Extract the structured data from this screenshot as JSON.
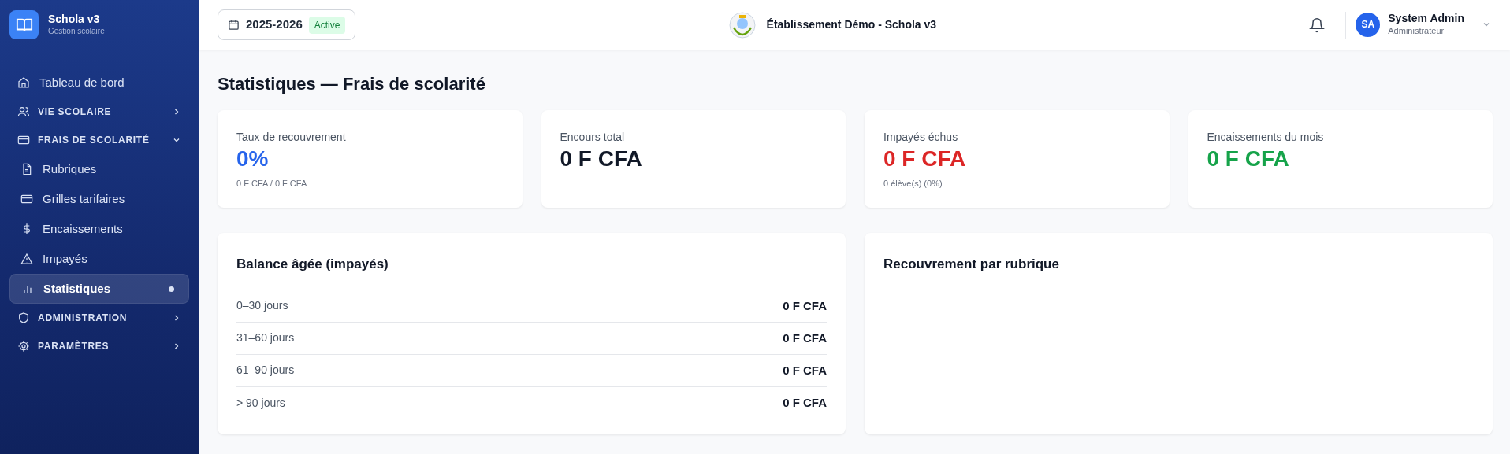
{
  "brand": {
    "name": "Schola v3",
    "subtitle": "Gestion scolaire"
  },
  "sidebar": {
    "items": [
      {
        "kind": "link",
        "label": "Tableau de bord",
        "selected": false
      },
      {
        "kind": "section",
        "label": "VIE SCOLAIRE",
        "expanded": false
      },
      {
        "kind": "section",
        "label": "FRAIS DE SCOLARITÉ",
        "expanded": true,
        "children": [
          {
            "kind": "link",
            "label": "Rubriques",
            "selected": false
          },
          {
            "kind": "link",
            "label": "Grilles tarifaires",
            "selected": false
          },
          {
            "kind": "link",
            "label": "Encaissements",
            "selected": false
          },
          {
            "kind": "link",
            "label": "Impayés",
            "selected": false
          },
          {
            "kind": "link",
            "label": "Statistiques",
            "selected": true
          }
        ]
      },
      {
        "kind": "section",
        "label": "ADMINISTRATION",
        "expanded": false
      },
      {
        "kind": "section",
        "label": "PARAMÈTRES",
        "expanded": false
      }
    ]
  },
  "header": {
    "year": "2025-2026",
    "year_badge": "Active",
    "school": "Établissement Démo - Schola v3",
    "user": {
      "initials": "SA",
      "name": "System Admin",
      "role": "Administrateur"
    }
  },
  "page_title": "Statistiques — Frais de scolarité",
  "kpis": [
    {
      "label": "Taux de recouvrement",
      "value": "0%",
      "color": "#2563eb",
      "note": "0 F CFA / 0 F CFA"
    },
    {
      "label": "Encours total",
      "value": "0 F CFA",
      "color": "#111827"
    },
    {
      "label": "Impayés échus",
      "value": "0 F CFA",
      "color": "#dc2626",
      "note": "0 élève(s) (0%)"
    },
    {
      "label": "Encaissements du mois",
      "value": "0 F CFA",
      "color": "#16a34a"
    }
  ],
  "aging": {
    "title": "Balance âgée (impayés)",
    "rows": [
      {
        "label": "0–30 jours",
        "amount": "0 F CFA"
      },
      {
        "label": "31–60 jours",
        "amount": "0 F CFA"
      },
      {
        "label": "61–90 jours",
        "amount": "0 F CFA"
      },
      {
        "label": "> 90 jours",
        "amount": "0 F CFA"
      }
    ]
  },
  "by_rubric": {
    "title": "Recouvrement par rubrique"
  }
}
